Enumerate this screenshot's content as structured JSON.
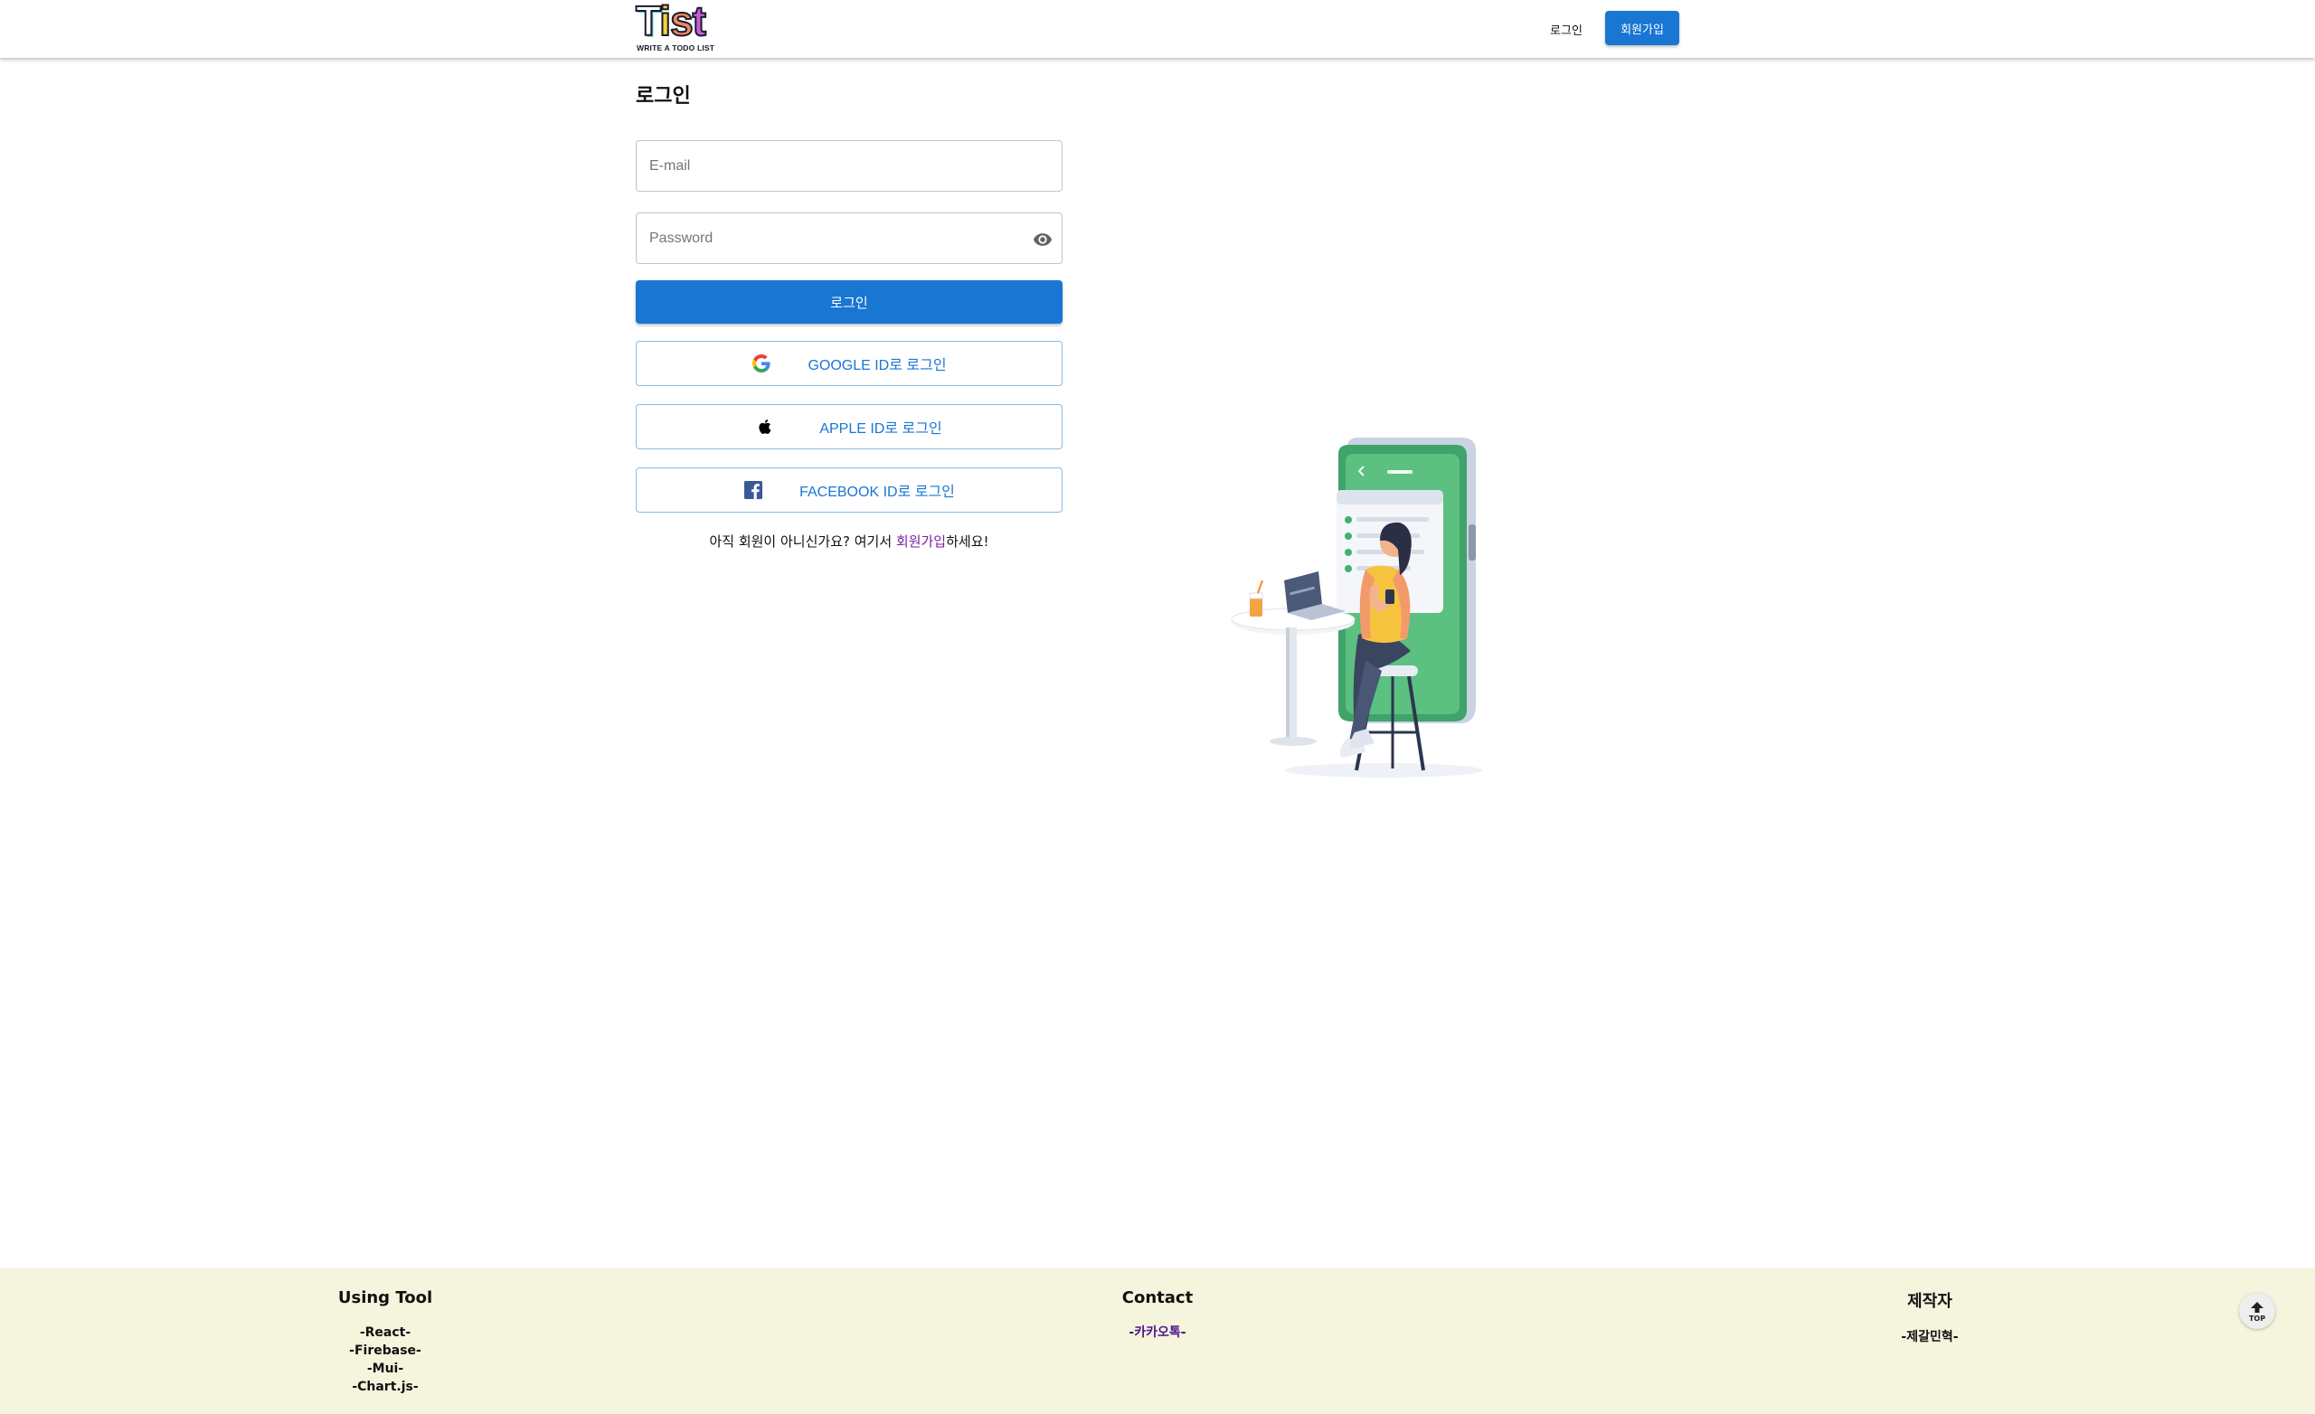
{
  "header": {
    "logo_text": "Tist",
    "logo_tagline": "WRITE A TODO LIST",
    "login_label": "로그인",
    "signup_label": "회원가입"
  },
  "login": {
    "title": "로그인",
    "email_placeholder": "E-mail",
    "password_placeholder": "Password",
    "submit_label": "로그인",
    "google_label": "GOOGLE ID로 로그인",
    "apple_label": "APPLE ID로 로그인",
    "facebook_label": "FACEBOOK ID로 로그인",
    "prompt_before": "아직 회원이 아니신가요? 여기서 ",
    "prompt_link": "회원가입",
    "prompt_after": "하세요!"
  },
  "footer": {
    "tools": {
      "title": "Using Tool",
      "items": [
        "-React-",
        "-Firebase-",
        "-Mui-",
        "-Chart.js-"
      ]
    },
    "contact": {
      "title": "Contact",
      "items": [
        "-카카오톡-"
      ]
    },
    "maker": {
      "title": "제작자",
      "items": [
        "-제갈민혁-"
      ]
    },
    "top_label": "TOP"
  },
  "colors": {
    "primary": "#1976d2",
    "footer_bg": "#f5f4dc",
    "link": "#7b1fa2"
  }
}
